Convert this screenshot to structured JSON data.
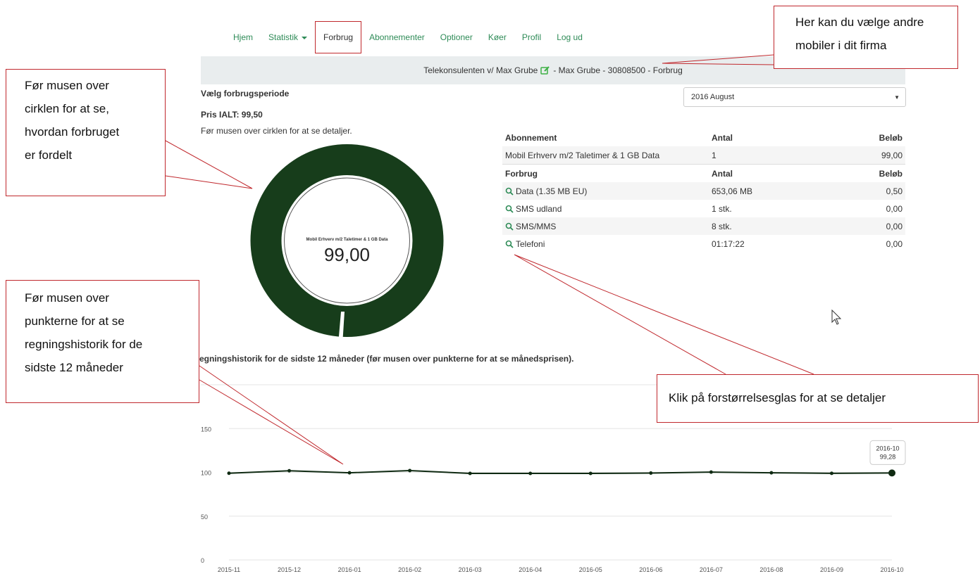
{
  "nav": {
    "items": [
      {
        "label": "Hjem"
      },
      {
        "label": "Statistik"
      },
      {
        "label": "Forbrug"
      },
      {
        "label": "Abonnementer"
      },
      {
        "label": "Optioner"
      },
      {
        "label": "Køer"
      },
      {
        "label": "Profil"
      },
      {
        "label": "Log ud"
      }
    ],
    "active": "Forbrug"
  },
  "banner": {
    "company": "Telekonsulenten v/ Max Grube",
    "rest": "- Max Grube - 30808500 - Forbrug"
  },
  "period": {
    "label": "Vælg forbrugsperiode",
    "selected": "2016 August"
  },
  "price_total": "Pris IALT: 99,50",
  "hover_hint": "Før musen over cirklen for at se detaljer.",
  "donut": {
    "caption": "Mobil Erhverv m/2 Taletimer & 1 GB Data",
    "value": "99,00",
    "color": "#173d1b"
  },
  "subscription_table": {
    "headers": [
      "Abonnement",
      "Antal",
      "Beløb"
    ],
    "rows": [
      {
        "name": "Mobil Erhverv m/2 Taletimer & 1 GB Data",
        "qty": "1",
        "amount": "99,00"
      }
    ]
  },
  "usage_table": {
    "headers": [
      "Forbrug",
      "Antal",
      "Beløb"
    ],
    "rows": [
      {
        "name": "Data (1.35 MB EU)",
        "qty": "653,06 MB",
        "amount": "0,50"
      },
      {
        "name": "SMS udland",
        "qty": "1 stk.",
        "amount": "0,00"
      },
      {
        "name": "SMS/MMS",
        "qty": "8 stk.",
        "amount": "0,00"
      },
      {
        "name": "Telefoni",
        "qty": "01:17:22",
        "amount": "0,00"
      }
    ]
  },
  "history_title": "egningshistorik for de sidste 12 måneder (før musen over punkterne for at se månedsprisen).",
  "chart_data": {
    "type": "line",
    "x": [
      "2015-11",
      "2015-12",
      "2016-01",
      "2016-02",
      "2016-03",
      "2016-04",
      "2016-05",
      "2016-06",
      "2016-07",
      "2016-08",
      "2016-09",
      "2016-10"
    ],
    "series": [
      {
        "values": [
          99.0,
          101.8,
          99.5,
          102.0,
          98.8,
          98.8,
          98.8,
          99.2,
          100.3,
          99.5,
          98.9,
          99.28
        ]
      }
    ],
    "yticks": [
      0,
      50,
      100,
      150
    ],
    "ylim": [
      0,
      200
    ],
    "grid": true,
    "line_color": "#0f2a12",
    "tooltip": {
      "label": "2016-10",
      "value": "99,28"
    }
  },
  "callouts": {
    "top_right": [
      "Her kan du vælge andre",
      "mobiler i dit firma"
    ],
    "left_top": [
      "Før musen over",
      "cirklen for at se,",
      "hvordan forbruget",
      "er fordelt"
    ],
    "left_bottom": [
      "Før musen over",
      "punkterne for at se",
      "regningshistorik for de",
      "sidste 12 måneder"
    ],
    "bottom_right": "Klik på forstørrelsesglas for at se detaljer"
  },
  "accent_color": "#c0282d",
  "link_color": "#2e8b57"
}
